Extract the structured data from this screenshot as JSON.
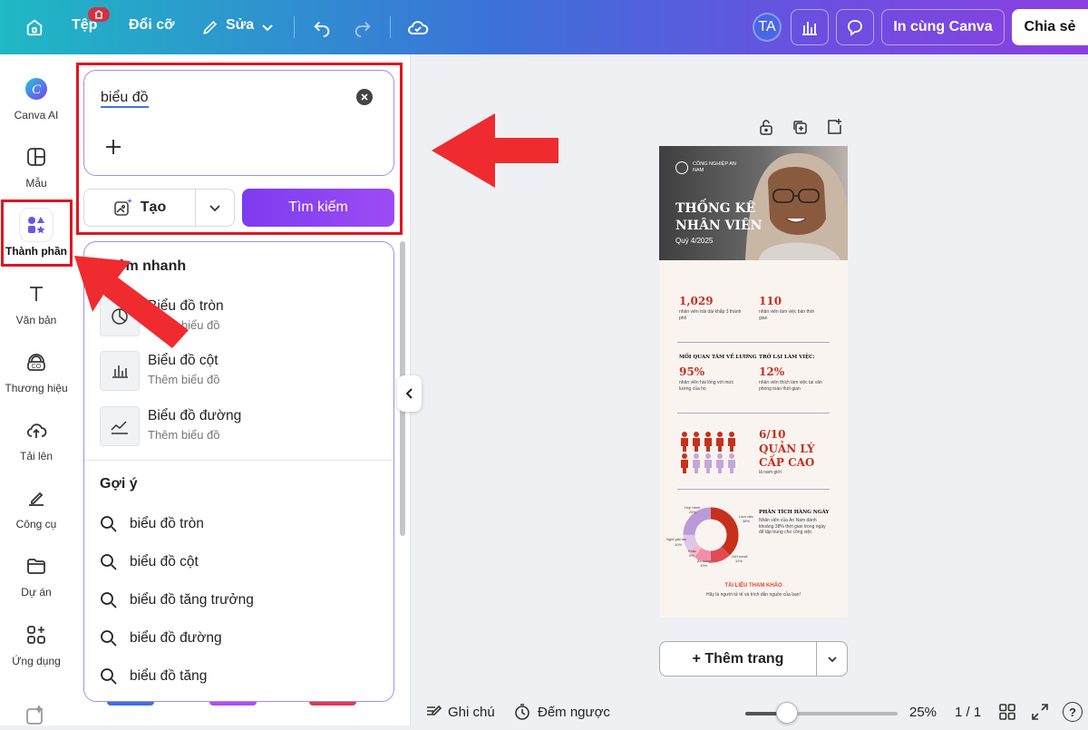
{
  "topbar": {
    "file": "Tệp",
    "file_badge": "",
    "resize": "Đổi cỡ",
    "edit": "Sửa",
    "avatar_initials": "TA",
    "print": "In cùng Canva",
    "share": "Chia sẻ"
  },
  "sidebar": {
    "items": [
      {
        "label": "Canva AI",
        "icon": "canva-ai-icon"
      },
      {
        "label": "Mẫu",
        "icon": "template-icon"
      },
      {
        "label": "Thành phần",
        "icon": "elements-icon"
      },
      {
        "label": "Văn bản",
        "icon": "text-icon"
      },
      {
        "label": "Thương hiệu",
        "icon": "brand-icon"
      },
      {
        "label": "Tải lên",
        "icon": "upload-icon"
      },
      {
        "label": "Công cụ",
        "icon": "tools-icon"
      },
      {
        "label": "Dự án",
        "icon": "folder-icon"
      },
      {
        "label": "Ứng dụng",
        "icon": "apps-icon"
      }
    ]
  },
  "panel": {
    "search_value": "biểu đồ",
    "generate_label": "Tạo",
    "search_button": "Tìm kiếm",
    "quick_add_title": "Thêm nhanh",
    "quick_add": [
      {
        "name": "Biểu đồ tròn",
        "sub": "Thêm biểu đồ"
      },
      {
        "name": "Biểu đồ cột",
        "sub": "Thêm biểu đồ"
      },
      {
        "name": "Biểu đồ đường",
        "sub": "Thêm biểu đồ"
      }
    ],
    "suggestions_title": "Gợi ý",
    "suggestions": [
      "biểu đồ tròn",
      "biểu đồ cột",
      "biểu đồ tăng trưởng",
      "biểu đồ đường",
      "biểu đồ tăng"
    ]
  },
  "design": {
    "company": "CÔNG NGHIỆP AN NAM",
    "title_line1": "THỐNG KÊ",
    "title_line2": "NHÂN VIÊN",
    "quarter": "Quý 4/2025",
    "stat1_value": "1,029",
    "stat1_desc": "nhân viên trải dài khắp 3 thành phố",
    "stat2_value": "110",
    "stat2_desc": "nhân viên làm việc bán thời gian",
    "heading3": "MỐI QUAN TÂM VỀ LƯƠNG",
    "stat3_value": "95%",
    "stat3_desc": "nhân viên hài lòng với mức lương của họ",
    "heading4": "TRỞ LẠI LÀM VIỆC:",
    "stat4_value": "12%",
    "stat4_desc": "nhân viên thích làm việc tại văn phòng toàn thời gian",
    "mgmt_value": "6/10",
    "mgmt_line1": "QUẢN LÝ",
    "mgmt_line2": "CẤP CAO",
    "mgmt_desc": "là nam giới",
    "daily_title": "PHÂN TÍCH HÀNG NGÀY",
    "daily_desc": "Nhân viên của An Nam dành khoảng 38% thời gian trong ngày để tập trung cho công việc",
    "donut_labels": [
      {
        "label": "Họp hành",
        "value": "25%"
      },
      {
        "label": "Làm việc",
        "value": "38%"
      },
      {
        "label": "Gửi email",
        "value": "12%"
      },
      {
        "label": "Ăn uống",
        "value": "10%"
      },
      {
        "label": "Khác",
        "value": "5%"
      },
      {
        "label": "Nghỉ giải lao",
        "value": "10%"
      }
    ],
    "ref_title": "TÀI LIỆU THAM KHẢO",
    "ref_desc": "Hãy là người tử tế và trích dẫn nguồn của bạn!"
  },
  "canvas": {
    "add_page": "+ Thêm trang"
  },
  "bottombar": {
    "notes": "Ghi chú",
    "timer": "Đếm ngược",
    "zoom": "25%",
    "page_count": "1 / 1",
    "zoom_fraction": 0.25
  },
  "colors": {
    "accent_purple": "#8b4cf4",
    "highlight_red": "#e0161e",
    "design_red": "#c7301c"
  }
}
